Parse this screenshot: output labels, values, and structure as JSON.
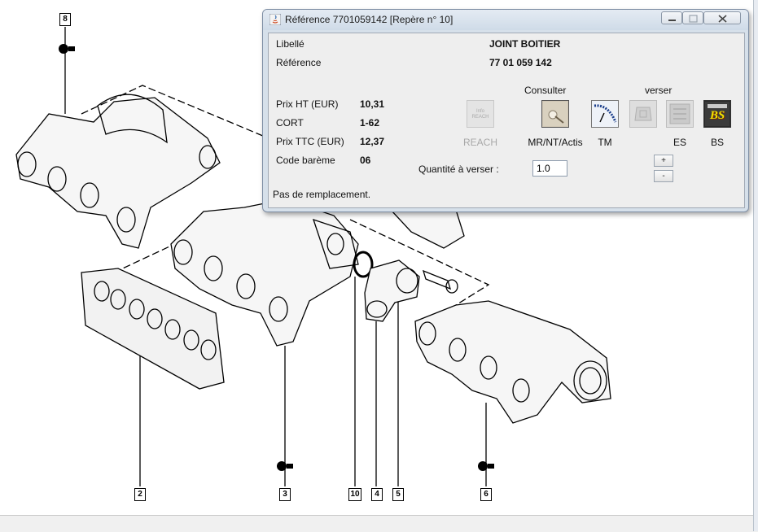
{
  "window": {
    "title": "Référence 7701059142 [Repère n° 10]"
  },
  "diagram": {
    "callouts": [
      "8",
      "2",
      "3",
      "10",
      "4",
      "5",
      "6"
    ]
  },
  "details": {
    "libelle_label": "Libellé",
    "libelle_value": "JOINT BOITIER",
    "reference_label": "Référence",
    "reference_value": "77 01 059 142",
    "prix_ht_label": "Prix HT (EUR)",
    "prix_ht_value": "10,31",
    "cort_label": "CORT",
    "cort_value": "1-62",
    "prix_ttc_label": "Prix TTC (EUR)",
    "prix_ttc_value": "12,37",
    "code_bareme_label": "Code barème",
    "code_bareme_value": "06",
    "status": "Pas de remplacement."
  },
  "actions": {
    "consulter_header": "Consulter",
    "verser_header": "verser",
    "reach_label": "REACH",
    "reach_icon_text": "Info REACH",
    "mrnt_label": "MR/NT/Actis",
    "tm_label": "TM",
    "es_label": "ES",
    "bs_label": "BS",
    "bs_icon_text": "BS"
  },
  "quantity": {
    "label": "Quantité à verser :",
    "value": "1.0",
    "plus": "+",
    "minus": "-"
  },
  "colors": {
    "dialog_bg": "#d6e0ea",
    "content_bg": "#eeeeee",
    "bs_yellow": "#f2e200"
  }
}
